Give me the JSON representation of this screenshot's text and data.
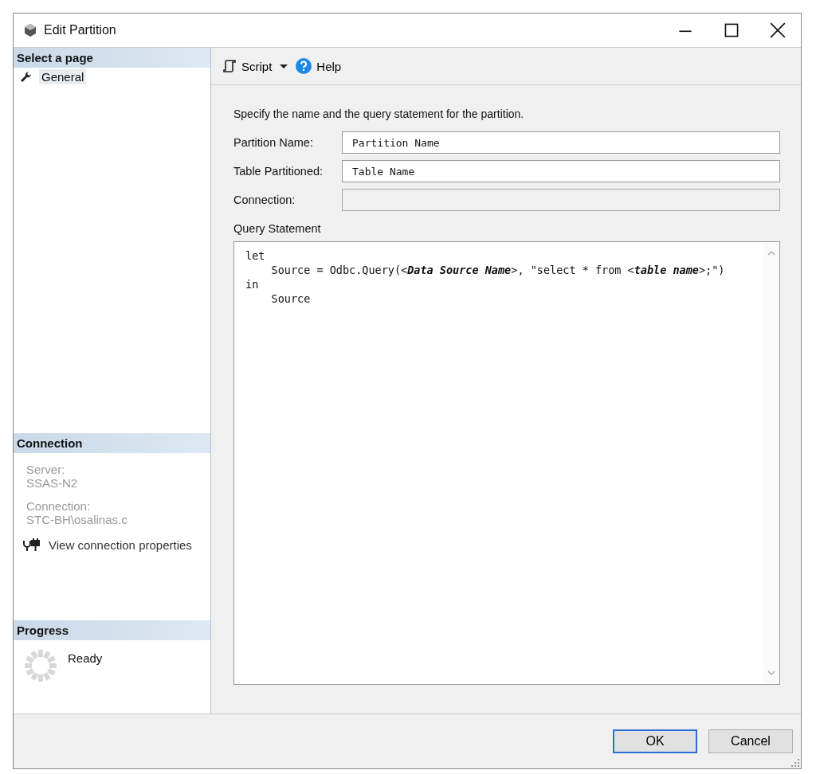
{
  "window": {
    "title": "Edit Partition"
  },
  "sidebar": {
    "select_header": "Select a page",
    "pages": [
      {
        "label": "General",
        "selected": true
      }
    ],
    "connection_header": "Connection",
    "server_label": "Server:",
    "server": "SSAS-N2",
    "connection_label": "Connection:",
    "connection": "STC-BH\\osalinas.c",
    "view_link": "View connection properties",
    "progress_header": "Progress",
    "progress_status": "Ready"
  },
  "toolbar": {
    "script": "Script",
    "help": "Help"
  },
  "form": {
    "description": "Specify the name and the query statement for the partition.",
    "fields": [
      {
        "label": "Partition Name:",
        "value": "Partition Name",
        "disabled": false
      },
      {
        "label": "Table Partitioned:",
        "value": "Table Name",
        "disabled": false
      },
      {
        "label": "Connection:",
        "disabled": true
      }
    ],
    "query_label": "Query Statement",
    "query_lines": [
      "let",
      "    Source = Odbc.Query(<*Data Source Name*>, \"select * from <*table name*>;\")",
      "in",
      "    Source"
    ]
  },
  "buttons": [
    {
      "label": "OK",
      "default": true
    },
    {
      "label": "Cancel",
      "default": false
    }
  ]
}
